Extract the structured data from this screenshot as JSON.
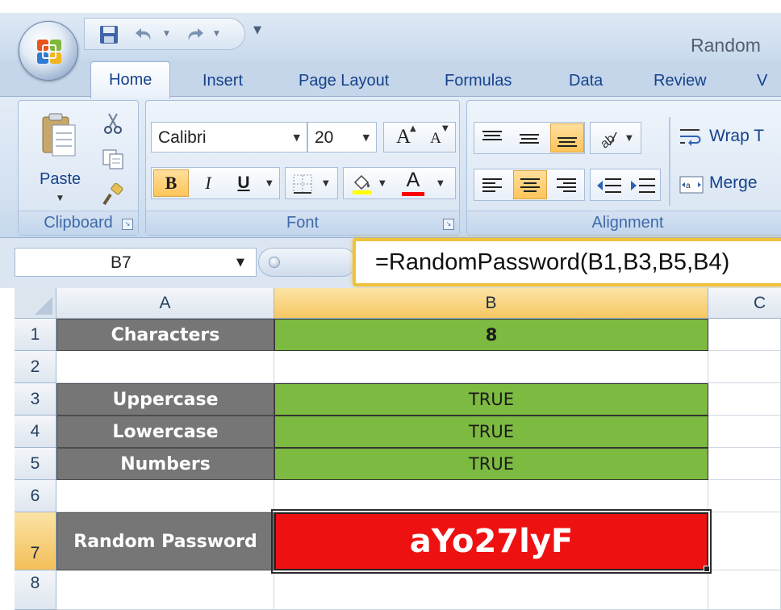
{
  "window": {
    "title": "Random"
  },
  "colors": {
    "label_fill": "#767676",
    "value_fill": "#7dba41",
    "result_fill": "#ee1111",
    "formula_highlight": "#f0c23c",
    "accent": "#15428b"
  },
  "quick_access": {
    "icons": [
      "save-icon",
      "undo-icon",
      "redo-icon",
      "customize-icon"
    ]
  },
  "ribbon": {
    "tabs": [
      {
        "label": "Home",
        "active": true
      },
      {
        "label": "Insert"
      },
      {
        "label": "Page Layout"
      },
      {
        "label": "Formulas"
      },
      {
        "label": "Data"
      },
      {
        "label": "Review"
      },
      {
        "label": "V"
      }
    ],
    "clipboard": {
      "label": "Clipboard",
      "paste_label": "Paste",
      "icons": [
        "cut-icon",
        "copy-icon",
        "format-painter-icon"
      ]
    },
    "font": {
      "label": "Font",
      "font_name": "Calibri",
      "font_size": "20",
      "grow_label": "A",
      "shrink_label": "A",
      "bold_label": "B",
      "italic_label": "I",
      "underline_label": "U",
      "font_color_label": "A",
      "icons": [
        "borders-icon",
        "fill-color-icon"
      ]
    },
    "alignment": {
      "label": "Alignment",
      "wrap_text": "Wrap T",
      "merge": "Merge",
      "icons": [
        "align-top-icon",
        "align-middle-icon",
        "align-bottom-icon",
        "orientation-icon",
        "align-left-icon",
        "align-center-icon",
        "align-right-icon",
        "decrease-indent-icon",
        "increase-indent-icon"
      ]
    }
  },
  "formula_bar": {
    "name_box": "B7",
    "formula": "=RandomPassword(B1,B3,B5,B4)"
  },
  "grid": {
    "columns": [
      "A",
      "B",
      "C"
    ],
    "rows": [
      "1",
      "2",
      "3",
      "4",
      "5",
      "6",
      "7",
      "8"
    ],
    "selected_cell": "B7",
    "cells": {
      "A1": "Characters",
      "B1": "8",
      "A3": "Uppercase",
      "B3": "TRUE",
      "A4": "Lowercase",
      "B4": "TRUE",
      "A5": "Numbers",
      "B5": "TRUE",
      "A7": "Random Password",
      "B7": "aYo27lyF"
    }
  }
}
